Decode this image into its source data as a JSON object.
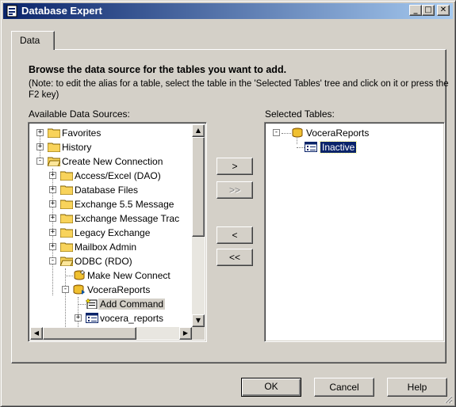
{
  "window": {
    "title": "Database Expert",
    "controls": {
      "minimize": "_",
      "maximize": "□",
      "close": "✕"
    }
  },
  "tabs": [
    {
      "label": "Data",
      "selected": true
    }
  ],
  "content": {
    "heading": "Browse the data source for the tables you want to add.",
    "note": "(Note: to edit the alias for a table, select the table in the 'Selected Tables' tree and click on it or press the F2 key)"
  },
  "available": {
    "label": "Available Data Sources:",
    "items": [
      {
        "label": "Favorites",
        "icon": "folder-icon",
        "expander": "+"
      },
      {
        "label": "History",
        "icon": "folder-icon",
        "expander": "+"
      },
      {
        "label": "Create New Connection",
        "icon": "folder-open-icon",
        "expander": "-"
      },
      {
        "label": "Access/Excel (DAO)",
        "icon": "folder-icon",
        "expander": "+"
      },
      {
        "label": "Database Files",
        "icon": "folder-icon",
        "expander": "+"
      },
      {
        "label": "Exchange 5.5 Message",
        "icon": "folder-icon",
        "expander": "+"
      },
      {
        "label": "Exchange Message Trac",
        "icon": "folder-icon",
        "expander": "+"
      },
      {
        "label": "Legacy Exchange",
        "icon": "folder-icon",
        "expander": "+"
      },
      {
        "label": "Mailbox Admin",
        "icon": "folder-icon",
        "expander": "+"
      },
      {
        "label": "ODBC (RDO)",
        "icon": "folder-open-icon",
        "expander": "-"
      },
      {
        "label": "Make New Connect",
        "icon": "new-connection-icon",
        "expander": ""
      },
      {
        "label": "VoceraReports",
        "icon": "database-connection-icon",
        "expander": "-"
      },
      {
        "label": "Add Command",
        "icon": "add-command-icon",
        "expander": ""
      },
      {
        "label": "vocera_reports",
        "icon": "table-icon",
        "expander": "+"
      }
    ]
  },
  "selected": {
    "label": "Selected Tables:",
    "root": {
      "label": "VoceraReports",
      "icon": "database-icon",
      "expander": "-"
    },
    "child": {
      "label": "Inactive",
      "icon": "table-icon"
    }
  },
  "transfer_buttons": {
    "add": ">",
    "add_all": ">>",
    "remove": "<",
    "remove_all": "<<"
  },
  "footer": {
    "ok": "OK",
    "cancel": "Cancel",
    "help": "Help"
  },
  "colors": {
    "titlebar_start": "#0a246a",
    "titlebar_end": "#a6caf0",
    "face": "#d4d0c8",
    "selection": "#0a246a"
  }
}
